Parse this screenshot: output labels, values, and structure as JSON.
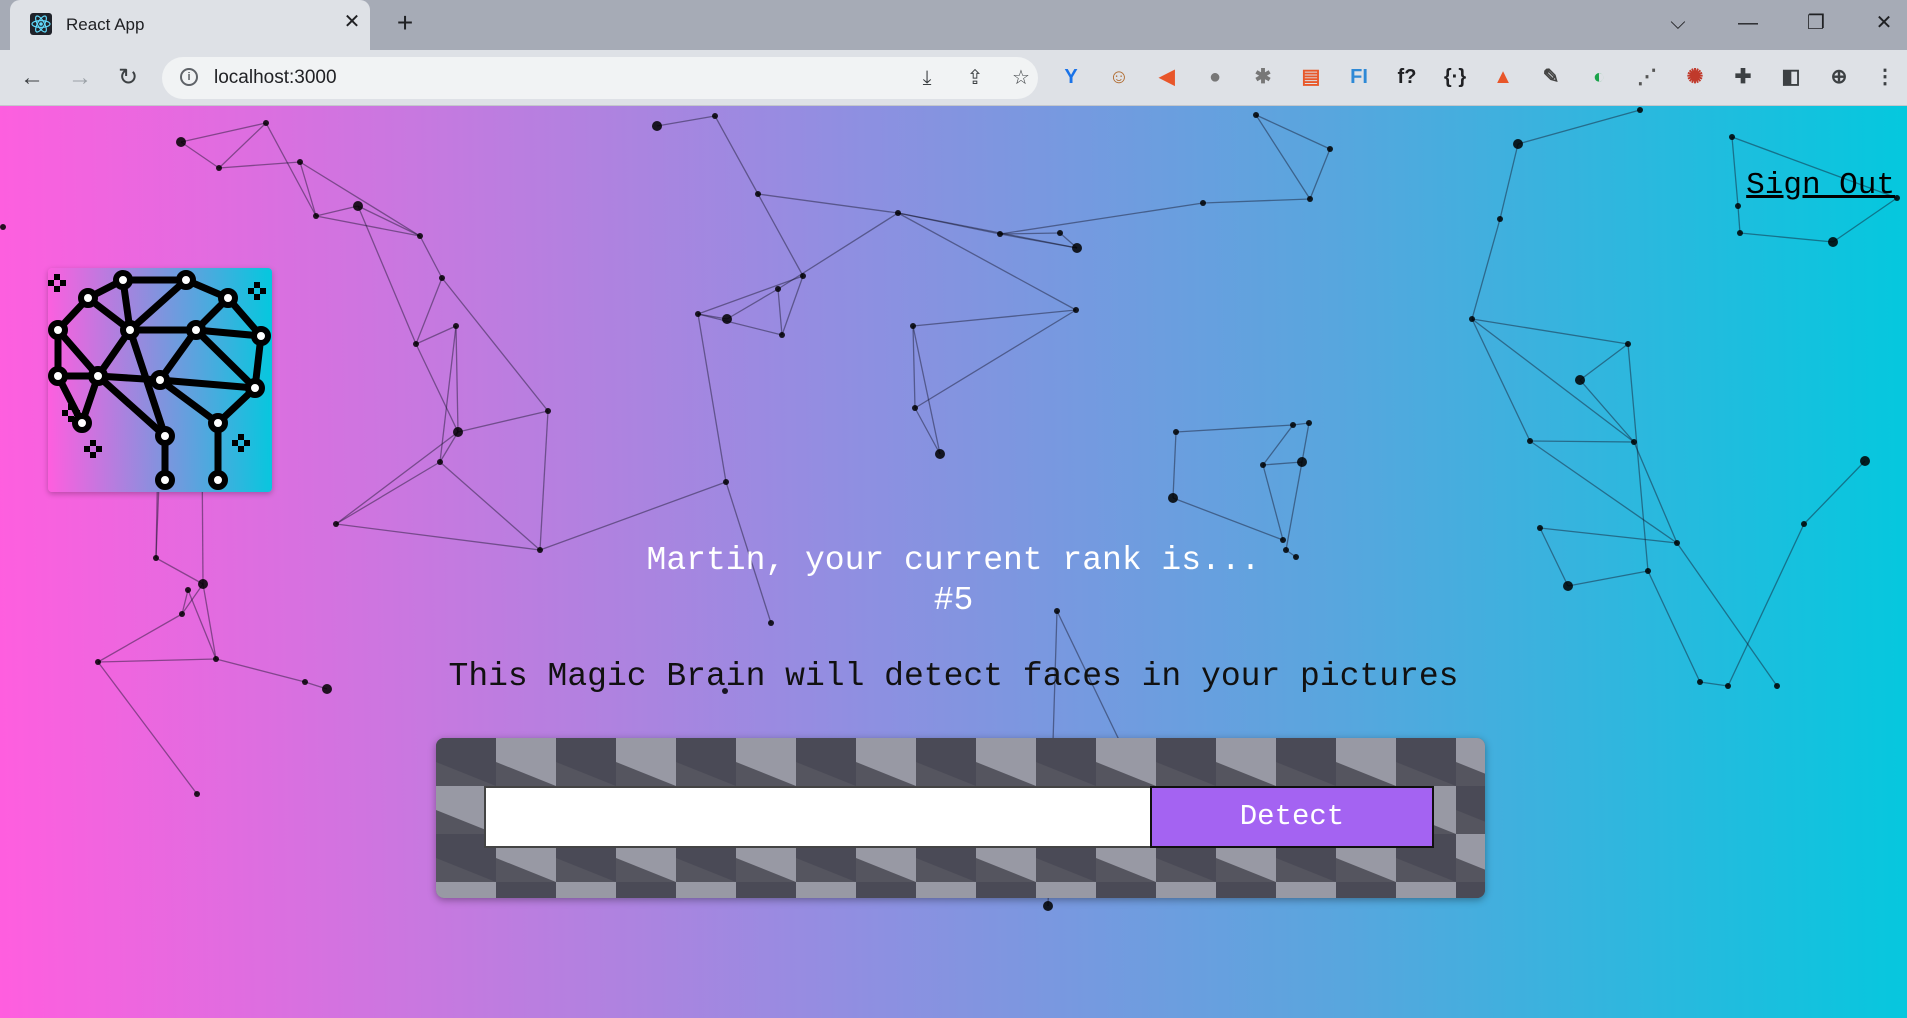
{
  "browser": {
    "tab_title": "React App",
    "tab_close": "✕",
    "new_tab": "+",
    "url": "localhost:3000",
    "window_controls": {
      "dropdown": "⌵",
      "minimize": "—",
      "restore": "❐",
      "close": "✕"
    },
    "nav": {
      "back": "←",
      "forward": "→",
      "reload": "↻"
    },
    "omnibox_icons": [
      "install-app-icon",
      "share-icon",
      "bookmark-star-icon"
    ],
    "extensions": [
      {
        "name": "ext-y-icon",
        "glyph": "Y",
        "color": "#1a73e8"
      },
      {
        "name": "ext-face-icon",
        "glyph": "☺",
        "color": "#b06b30"
      },
      {
        "name": "ext-megaphone-icon",
        "glyph": "◀",
        "color": "#e8562a"
      },
      {
        "name": "ext-tomato-icon",
        "glyph": "●",
        "color": "#777777"
      },
      {
        "name": "ext-bug-icon",
        "glyph": "✱",
        "color": "#777777"
      },
      {
        "name": "ext-calendar-icon",
        "glyph": "▤",
        "color": "#e8582a"
      },
      {
        "name": "ext-fi-icon",
        "glyph": "FI",
        "color": "#2e89d6"
      },
      {
        "name": "ext-font-icon",
        "glyph": "f?",
        "color": "#202124"
      },
      {
        "name": "ext-json-icon",
        "glyph": "{·}",
        "color": "#202124"
      },
      {
        "name": "ext-lighthouse-icon",
        "glyph": "▲",
        "color": "#e8562a"
      },
      {
        "name": "ext-eyedropper-icon",
        "glyph": "✎",
        "color": "#444444"
      },
      {
        "name": "ext-color-icon",
        "glyph": "◐",
        "color": "#1aa34a"
      },
      {
        "name": "ext-dots-icon",
        "glyph": "⋰",
        "color": "#555555"
      },
      {
        "name": "ext-puzzle-red-icon",
        "glyph": "✺",
        "color": "#c0392b"
      },
      {
        "name": "extensions-icon",
        "glyph": "✚",
        "color": "#3c4043"
      },
      {
        "name": "side-panel-icon",
        "glyph": "◧",
        "color": "#3c4043"
      },
      {
        "name": "profile-icon",
        "glyph": "⊕",
        "color": "#3c4043"
      },
      {
        "name": "menu-icon",
        "glyph": "⋮",
        "color": "#3c4043"
      }
    ]
  },
  "page": {
    "sign_out": "Sign Out",
    "rank_line": "Martin, your current rank is...",
    "rank_value": "#5",
    "tagline": "This Magic Brain will detect faces in your pictures",
    "input_value": "",
    "detect_label": "Detect"
  },
  "colors": {
    "gradient_left": "#ff5edf",
    "gradient_right": "#04c8de",
    "detect_button": "#a463f2",
    "form_pattern_dark": "#4a4a56",
    "form_pattern_light": "#9899a4"
  }
}
